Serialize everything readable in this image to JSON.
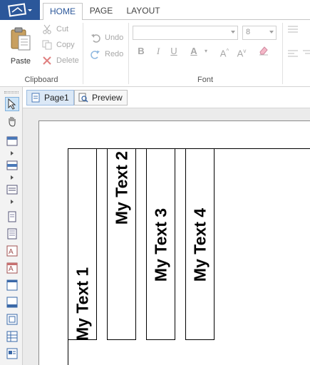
{
  "ribbon_tabs": [
    {
      "label": "HOME",
      "active": true
    },
    {
      "label": "PAGE",
      "active": false
    },
    {
      "label": "LAYOUT",
      "active": false
    }
  ],
  "clipboard": {
    "paste_label": "Paste",
    "cut_label": "Cut",
    "copy_label": "Copy",
    "delete_label": "Delete",
    "group_label": "Clipboard"
  },
  "history": {
    "undo_label": "Undo",
    "redo_label": "Redo"
  },
  "font": {
    "family_value": "",
    "size_value": "8",
    "group_label": "Font",
    "bold": "B",
    "italic": "I",
    "underline": "U",
    "font_color": "A",
    "grow": "A",
    "shrink": "A"
  },
  "doc_tabs": [
    {
      "label": "Page1",
      "active": true
    },
    {
      "label": "Preview",
      "active": false
    }
  ],
  "report_items": [
    {
      "text": "My Text 1",
      "align": "bottom"
    },
    {
      "text": "My Text 2",
      "align": "top"
    },
    {
      "text": "My Text 3",
      "align": "center"
    },
    {
      "text": "My Text 4",
      "align": "center"
    }
  ],
  "colors": {
    "accent": "#2b579a",
    "selection": "#cde4f7"
  }
}
